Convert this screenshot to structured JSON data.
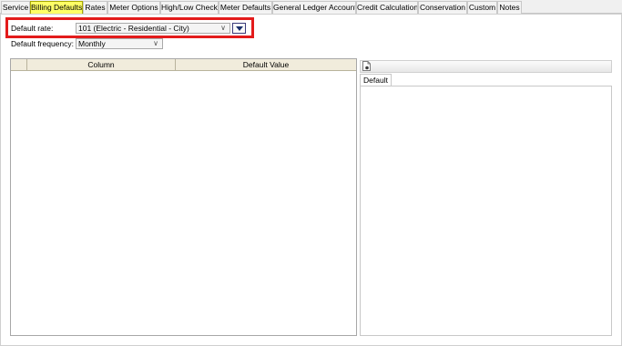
{
  "tabs": [
    {
      "label": "Service"
    },
    {
      "label": "Billing Defaults"
    },
    {
      "label": "Rates"
    },
    {
      "label": "Meter Options"
    },
    {
      "label": "High/Low Checks"
    },
    {
      "label": "Meter Defaults"
    },
    {
      "label": "General Ledger Accounts"
    },
    {
      "label": "Credit Calculation"
    },
    {
      "label": "Conservation"
    },
    {
      "label": "Custom"
    },
    {
      "label": "Notes"
    }
  ],
  "active_tab": "Billing Defaults",
  "form": {
    "default_rate_label": "Default rate:",
    "default_rate_value": "101 (Electric - Residential - City)",
    "default_frequency_label": "Default frequency:",
    "default_frequency_value": "Monthly"
  },
  "grid": {
    "columns": [
      "",
      "Column",
      "Default Value"
    ]
  },
  "right_panel": {
    "tab_label": "Default"
  },
  "colors": {
    "active_tab": "#ffff66",
    "highlight_border": "#e31b1b",
    "grid_header": "#f1ecdc"
  }
}
